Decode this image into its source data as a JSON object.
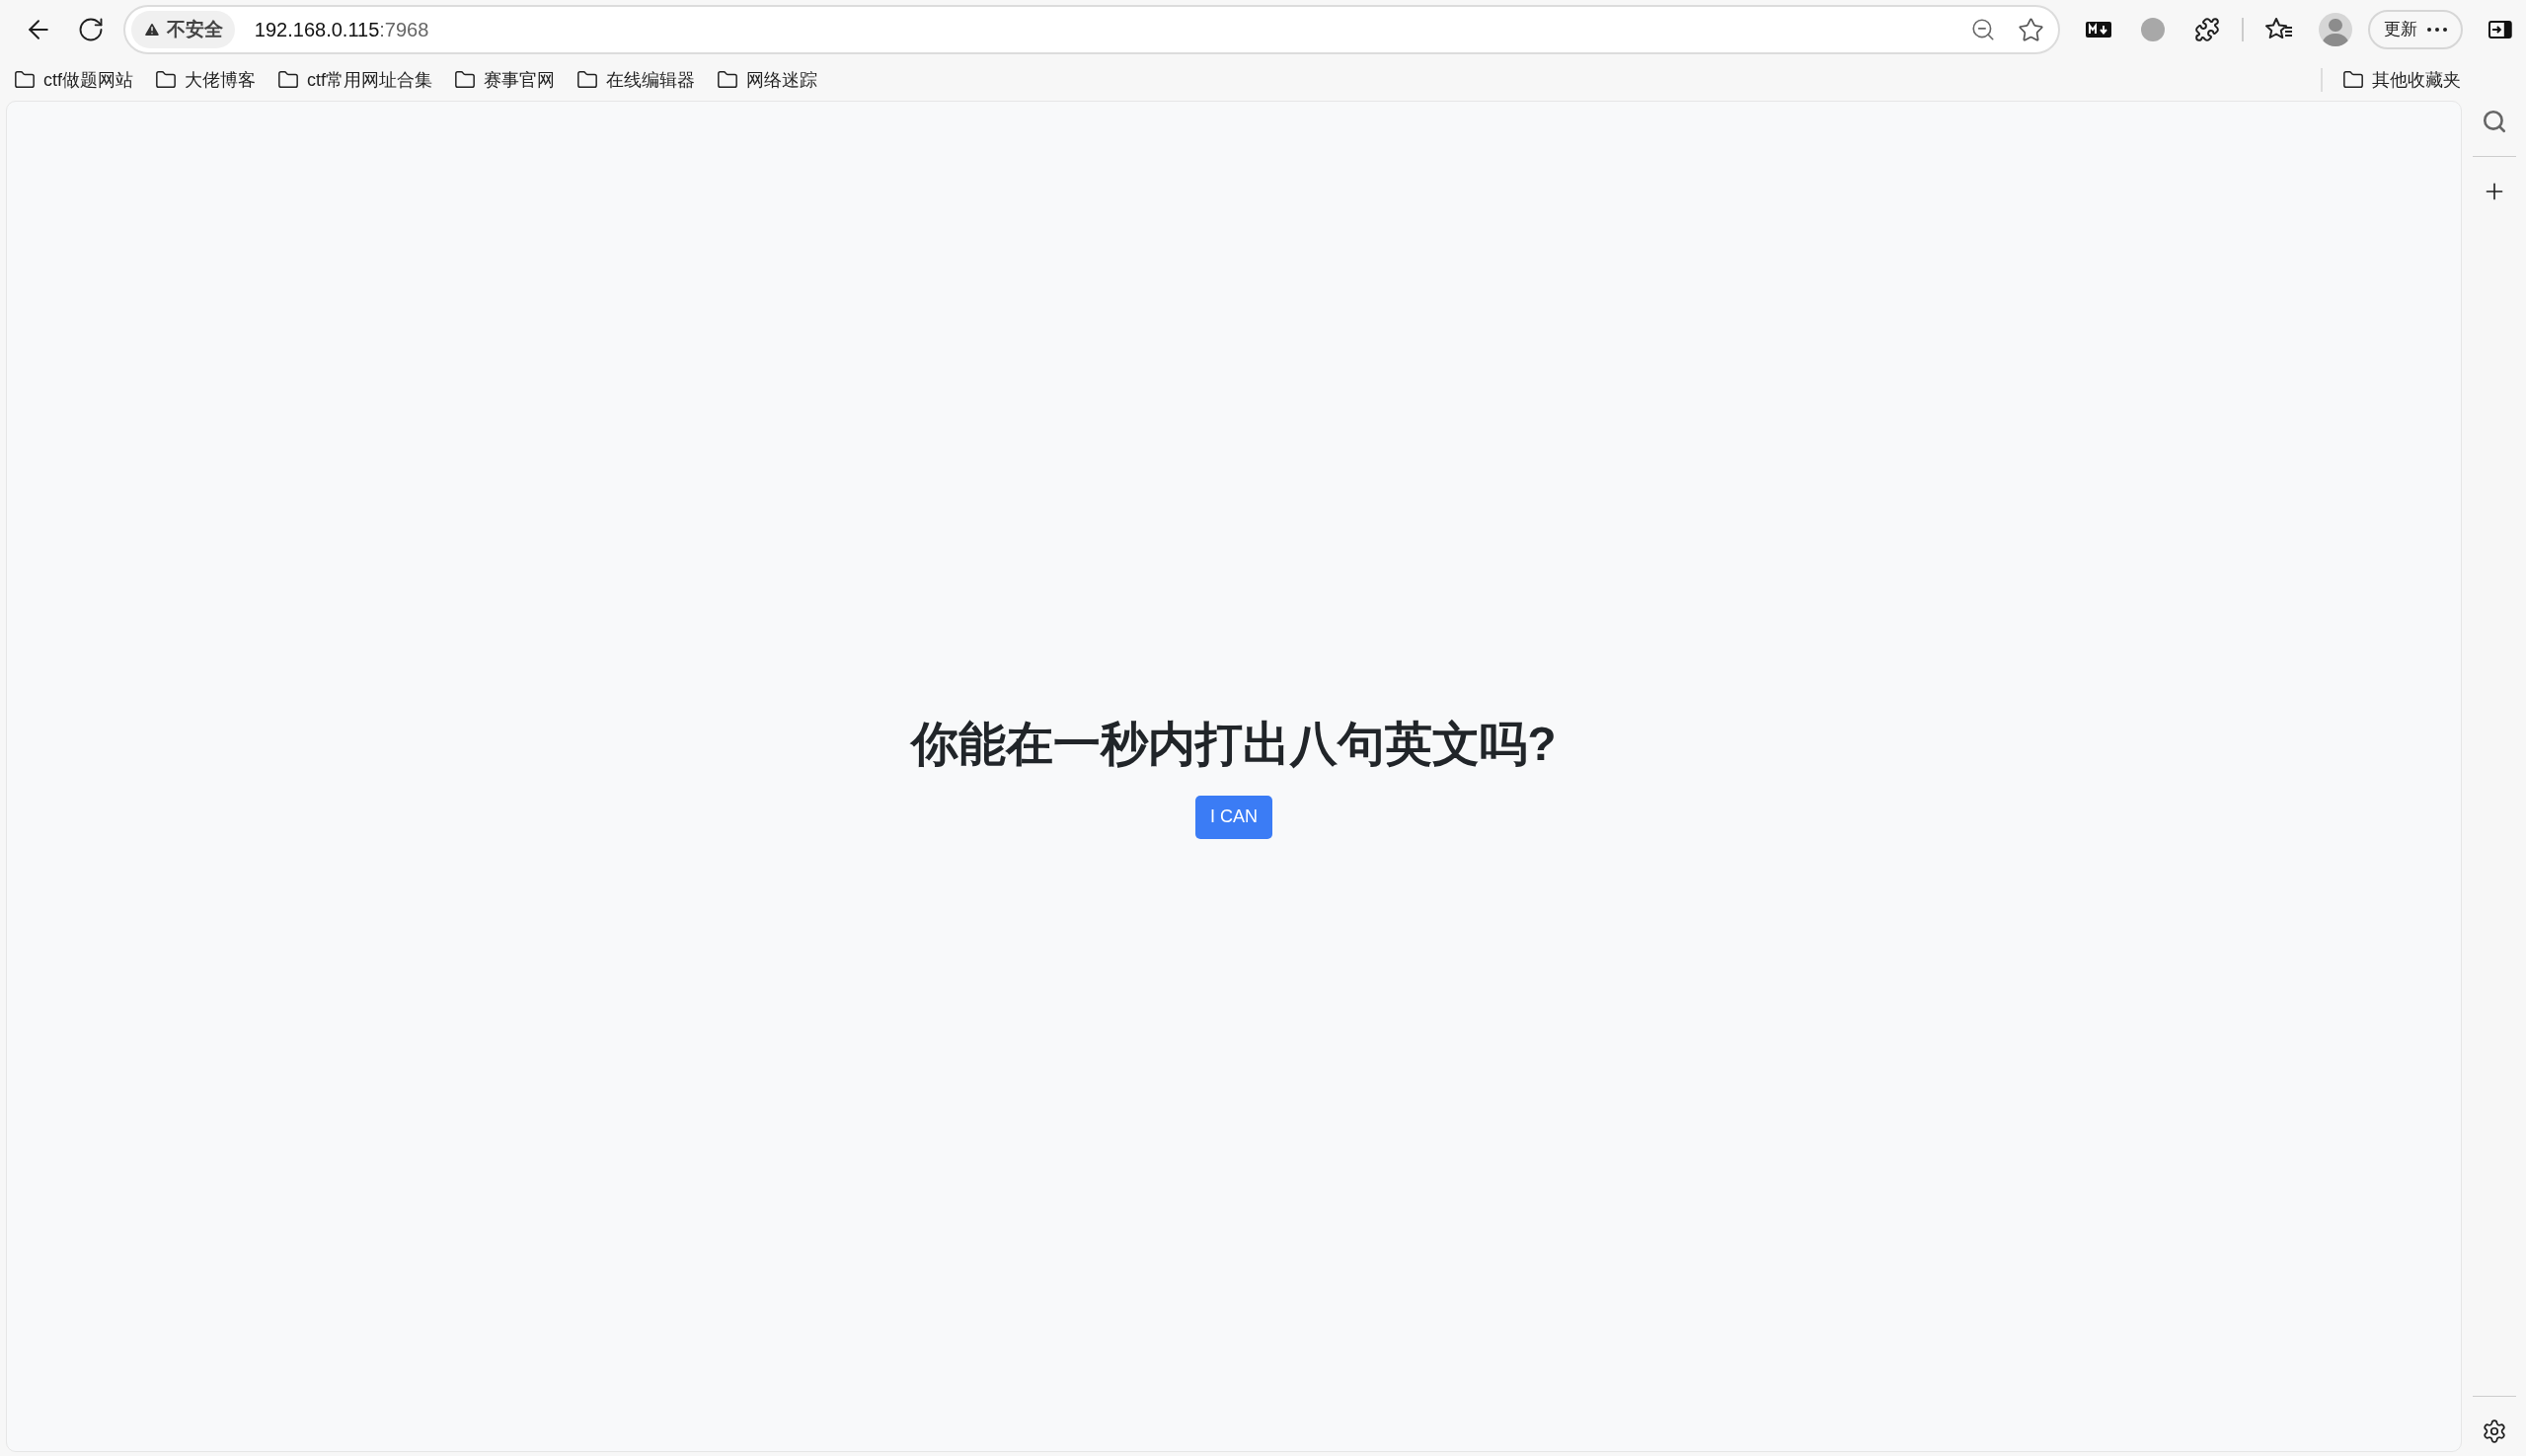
{
  "toolbar": {
    "security_label": "不安全",
    "url_host": "192.168.0.115",
    "url_port": ":7968",
    "update_button": "更新"
  },
  "bookmarks": [
    {
      "label": "ctf做题网站"
    },
    {
      "label": "大佬博客"
    },
    {
      "label": "ctf常用网址合集"
    },
    {
      "label": "赛事官网"
    },
    {
      "label": "在线编辑器"
    },
    {
      "label": "网络迷踪"
    }
  ],
  "other_bookmarks": {
    "label": "其他收藏夹"
  },
  "page": {
    "heading": "你能在一秒内打出八句英文吗?",
    "button": "I CAN"
  }
}
